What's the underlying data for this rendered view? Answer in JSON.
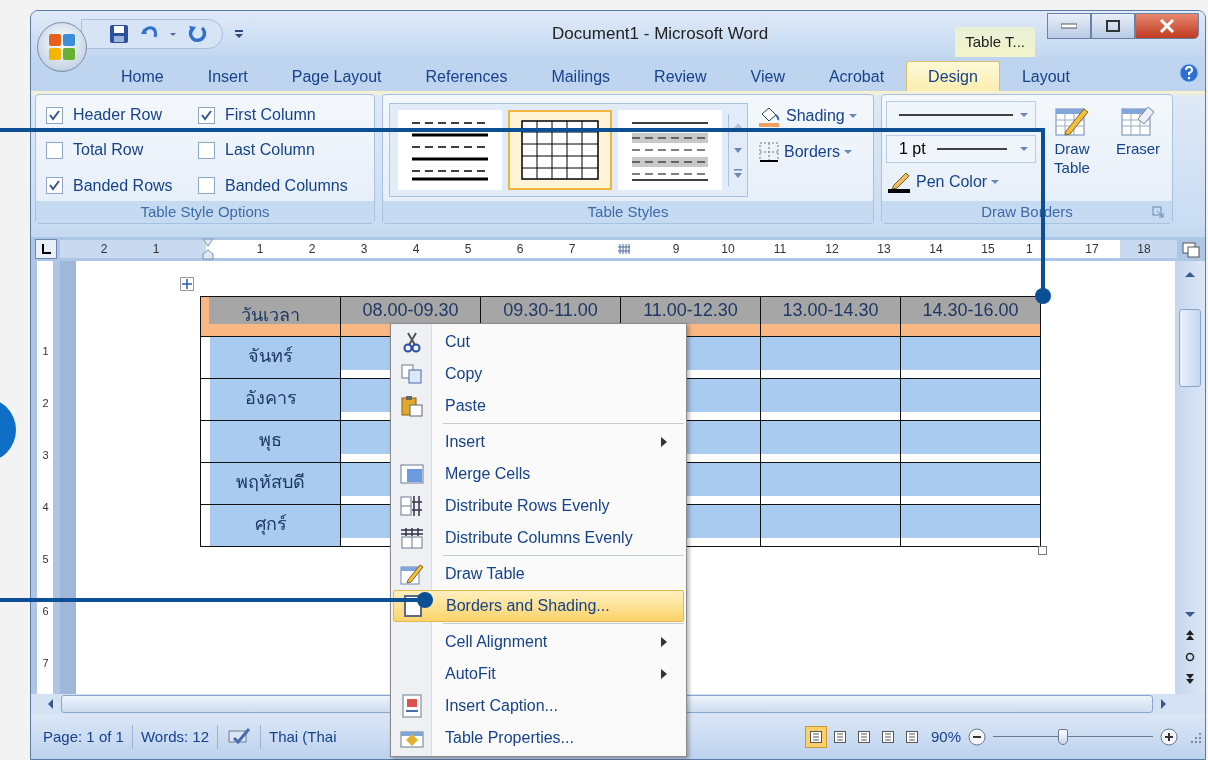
{
  "window": {
    "title": "Document1 - Microsoft Word",
    "contextual_tab": "Table T..."
  },
  "tabs": [
    {
      "label": "Home",
      "selected": false
    },
    {
      "label": "Insert",
      "selected": false
    },
    {
      "label": "Page Layout",
      "selected": false
    },
    {
      "label": "References",
      "selected": false
    },
    {
      "label": "Mailings",
      "selected": false
    },
    {
      "label": "Review",
      "selected": false
    },
    {
      "label": "View",
      "selected": false
    },
    {
      "label": "Acrobat",
      "selected": false
    },
    {
      "label": "Design",
      "selected": true
    },
    {
      "label": "Layout",
      "selected": false
    }
  ],
  "ribbon": {
    "table_style_options": {
      "label": "Table Style Options",
      "options": [
        {
          "label": "Header Row",
          "checked": true
        },
        {
          "label": "First Column",
          "checked": true
        },
        {
          "label": "Total Row",
          "checked": false
        },
        {
          "label": "Last Column",
          "checked": false
        },
        {
          "label": "Banded Rows",
          "checked": true
        },
        {
          "label": "Banded Columns",
          "checked": false
        }
      ]
    },
    "table_styles": {
      "label": "Table Styles",
      "styles": [
        {
          "kind": "lines",
          "selected": false
        },
        {
          "kind": "grid",
          "selected": true
        },
        {
          "kind": "shaded",
          "selected": false
        }
      ],
      "shading": "Shading",
      "borders": "Borders"
    },
    "draw_borders": {
      "label": "Draw Borders",
      "line_weight": "1 pt",
      "pen_color": "Pen Color",
      "draw_table": "Draw Table",
      "eraser": "Eraser"
    }
  },
  "ruler": {
    "marks": [
      {
        "kind": "number",
        "label": "2"
      },
      {
        "kind": "number",
        "label": "1"
      },
      {
        "kind": "indent"
      },
      {
        "kind": "number",
        "label": "1"
      },
      {
        "kind": "number",
        "label": "2"
      },
      {
        "kind": "number",
        "label": "3"
      },
      {
        "kind": "number",
        "label": "4"
      },
      {
        "kind": "number",
        "label": "5"
      },
      {
        "kind": "number",
        "label": "6"
      },
      {
        "kind": "number",
        "label": "7"
      },
      {
        "kind": "column"
      },
      {
        "kind": "number",
        "label": "9"
      },
      {
        "kind": "number",
        "label": "10"
      },
      {
        "kind": "number",
        "label": "11"
      },
      {
        "kind": "number",
        "label": "12"
      },
      {
        "kind": "number",
        "label": "13"
      },
      {
        "kind": "number",
        "label": "14"
      },
      {
        "kind": "number",
        "label": "15"
      },
      {
        "kind": "partial",
        "label": "1"
      },
      {
        "kind": "number",
        "label": "17"
      },
      {
        "kind": "number",
        "label": "18"
      }
    ]
  },
  "vertical_ruler": {
    "numbers": [
      "1",
      "2",
      "3",
      "4",
      "5",
      "6",
      "7"
    ]
  },
  "table": {
    "header": [
      "วันเวลา",
      "08.00-09.30",
      "09.30-11.00",
      "11.00-12.30",
      "13.00-14.30",
      "14.30-16.00"
    ],
    "rows": [
      "จันทร์",
      "อังคาร",
      "พุธ",
      "พฤหัสบดี",
      "ศุกร์"
    ]
  },
  "context_menu": {
    "items": [
      {
        "label": "Cut",
        "submenu": false,
        "separator_before": false,
        "selected": false
      },
      {
        "label": "Copy",
        "submenu": false,
        "separator_before": false,
        "selected": false
      },
      {
        "label": "Paste",
        "submenu": false,
        "separator_before": false,
        "selected": false
      },
      {
        "label": "Insert",
        "submenu": true,
        "separator_before": true,
        "selected": false
      },
      {
        "label": "Merge Cells",
        "submenu": false,
        "separator_before": false,
        "selected": false
      },
      {
        "label": "Distribute Rows Evenly",
        "submenu": false,
        "separator_before": false,
        "selected": false
      },
      {
        "label": "Distribute Columns Evenly",
        "submenu": false,
        "separator_before": false,
        "selected": false
      },
      {
        "label": "Draw Table",
        "submenu": false,
        "separator_before": true,
        "selected": false
      },
      {
        "label": "Borders and Shading...",
        "submenu": false,
        "separator_before": false,
        "selected": true
      },
      {
        "label": "Cell Alignment",
        "submenu": true,
        "separator_before": true,
        "selected": false
      },
      {
        "label": "AutoFit",
        "submenu": true,
        "separator_before": false,
        "selected": false
      },
      {
        "label": "Insert Caption...",
        "submenu": false,
        "separator_before": false,
        "selected": false
      },
      {
        "label": "Table Properties...",
        "submenu": false,
        "separator_before": false,
        "selected": false
      }
    ]
  },
  "status_bar": {
    "page": "Page: 1 of 1",
    "words": "Words: 12",
    "language": "Thai (Thai",
    "view_buttons": [
      {
        "selected": true
      },
      {
        "selected": false
      },
      {
        "selected": false
      },
      {
        "selected": false
      },
      {
        "selected": false
      }
    ],
    "zoom": "90%",
    "zoom_slider": {
      "level": 0.44
    }
  }
}
